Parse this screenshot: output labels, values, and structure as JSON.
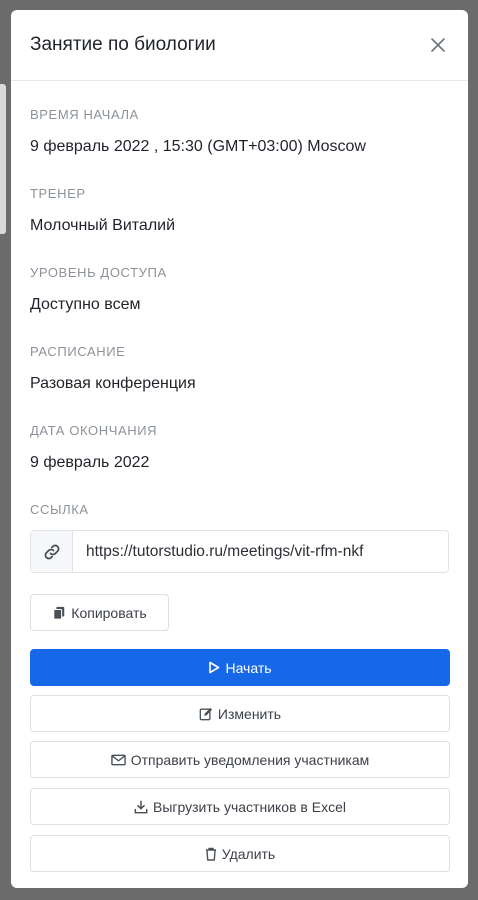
{
  "modal": {
    "title": "Занятие по биологии"
  },
  "details": {
    "start_time_label": "ВРЕМЯ НАЧАЛА",
    "start_time_value": "9 февраль 2022 , 15:30 (GMT+03:00) Moscow",
    "trainer_label": "ТРЕНЕР",
    "trainer_value": "Молочный Виталий",
    "access_label": "УРОВЕНЬ ДОСТУПА",
    "access_value": "Доступно всем",
    "schedule_label": "РАСПИСАНИЕ",
    "schedule_value": "Разовая конференция",
    "end_date_label": "ДАТА ОКОНЧАНИЯ",
    "end_date_value": "9 февраль 2022",
    "link_label": "ССЫЛКА",
    "link_value": "https://tutorstudio.ru/meetings/vit-rfm-nkf"
  },
  "actions": {
    "copy": "Копировать",
    "start": "Начать",
    "edit": "Изменить",
    "notify": "Отправить уведомления участникам",
    "export": "Выгрузить участников в Excel",
    "delete": "Удалить"
  },
  "icons": {
    "close": "close-icon",
    "link": "link-icon",
    "copy": "copy-icon",
    "play": "play-icon",
    "edit": "edit-icon",
    "mail": "mail-icon",
    "download": "download-icon",
    "trash": "trash-icon"
  },
  "colors": {
    "primary": "#1768e8",
    "label": "#8c9299",
    "text": "#1f2329"
  }
}
